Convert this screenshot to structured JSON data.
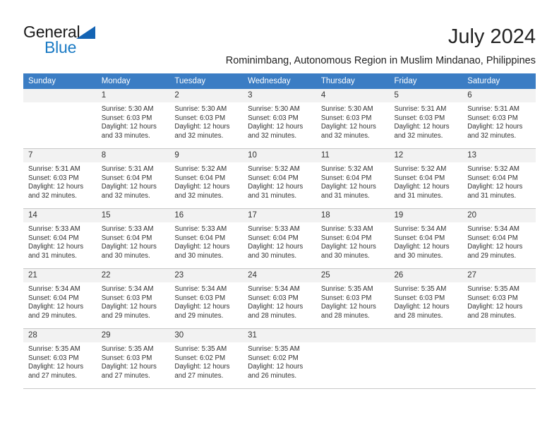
{
  "brand": {
    "name_top": "General",
    "name_bottom": "Blue",
    "accent_color": "#1a7ac4",
    "triangle_color": "#1464b4"
  },
  "header": {
    "title": "July 2024",
    "subtitle": "Rominimbang, Autonomous Region in Muslim Mindanao, Philippines"
  },
  "calendar": {
    "header_bg": "#3b7dc4",
    "daynum_bg": "#f2f2f2",
    "weekday_headers": [
      "Sunday",
      "Monday",
      "Tuesday",
      "Wednesday",
      "Thursday",
      "Friday",
      "Saturday"
    ],
    "weeks": [
      [
        {
          "day": "",
          "lines": []
        },
        {
          "day": "1",
          "lines": [
            "Sunrise: 5:30 AM",
            "Sunset: 6:03 PM",
            "Daylight: 12 hours",
            "and 33 minutes."
          ]
        },
        {
          "day": "2",
          "lines": [
            "Sunrise: 5:30 AM",
            "Sunset: 6:03 PM",
            "Daylight: 12 hours",
            "and 32 minutes."
          ]
        },
        {
          "day": "3",
          "lines": [
            "Sunrise: 5:30 AM",
            "Sunset: 6:03 PM",
            "Daylight: 12 hours",
            "and 32 minutes."
          ]
        },
        {
          "day": "4",
          "lines": [
            "Sunrise: 5:30 AM",
            "Sunset: 6:03 PM",
            "Daylight: 12 hours",
            "and 32 minutes."
          ]
        },
        {
          "day": "5",
          "lines": [
            "Sunrise: 5:31 AM",
            "Sunset: 6:03 PM",
            "Daylight: 12 hours",
            "and 32 minutes."
          ]
        },
        {
          "day": "6",
          "lines": [
            "Sunrise: 5:31 AM",
            "Sunset: 6:03 PM",
            "Daylight: 12 hours",
            "and 32 minutes."
          ]
        }
      ],
      [
        {
          "day": "7",
          "lines": [
            "Sunrise: 5:31 AM",
            "Sunset: 6:03 PM",
            "Daylight: 12 hours",
            "and 32 minutes."
          ]
        },
        {
          "day": "8",
          "lines": [
            "Sunrise: 5:31 AM",
            "Sunset: 6:04 PM",
            "Daylight: 12 hours",
            "and 32 minutes."
          ]
        },
        {
          "day": "9",
          "lines": [
            "Sunrise: 5:32 AM",
            "Sunset: 6:04 PM",
            "Daylight: 12 hours",
            "and 32 minutes."
          ]
        },
        {
          "day": "10",
          "lines": [
            "Sunrise: 5:32 AM",
            "Sunset: 6:04 PM",
            "Daylight: 12 hours",
            "and 31 minutes."
          ]
        },
        {
          "day": "11",
          "lines": [
            "Sunrise: 5:32 AM",
            "Sunset: 6:04 PM",
            "Daylight: 12 hours",
            "and 31 minutes."
          ]
        },
        {
          "day": "12",
          "lines": [
            "Sunrise: 5:32 AM",
            "Sunset: 6:04 PM",
            "Daylight: 12 hours",
            "and 31 minutes."
          ]
        },
        {
          "day": "13",
          "lines": [
            "Sunrise: 5:32 AM",
            "Sunset: 6:04 PM",
            "Daylight: 12 hours",
            "and 31 minutes."
          ]
        }
      ],
      [
        {
          "day": "14",
          "lines": [
            "Sunrise: 5:33 AM",
            "Sunset: 6:04 PM",
            "Daylight: 12 hours",
            "and 31 minutes."
          ]
        },
        {
          "day": "15",
          "lines": [
            "Sunrise: 5:33 AM",
            "Sunset: 6:04 PM",
            "Daylight: 12 hours",
            "and 30 minutes."
          ]
        },
        {
          "day": "16",
          "lines": [
            "Sunrise: 5:33 AM",
            "Sunset: 6:04 PM",
            "Daylight: 12 hours",
            "and 30 minutes."
          ]
        },
        {
          "day": "17",
          "lines": [
            "Sunrise: 5:33 AM",
            "Sunset: 6:04 PM",
            "Daylight: 12 hours",
            "and 30 minutes."
          ]
        },
        {
          "day": "18",
          "lines": [
            "Sunrise: 5:33 AM",
            "Sunset: 6:04 PM",
            "Daylight: 12 hours",
            "and 30 minutes."
          ]
        },
        {
          "day": "19",
          "lines": [
            "Sunrise: 5:34 AM",
            "Sunset: 6:04 PM",
            "Daylight: 12 hours",
            "and 30 minutes."
          ]
        },
        {
          "day": "20",
          "lines": [
            "Sunrise: 5:34 AM",
            "Sunset: 6:04 PM",
            "Daylight: 12 hours",
            "and 29 minutes."
          ]
        }
      ],
      [
        {
          "day": "21",
          "lines": [
            "Sunrise: 5:34 AM",
            "Sunset: 6:04 PM",
            "Daylight: 12 hours",
            "and 29 minutes."
          ]
        },
        {
          "day": "22",
          "lines": [
            "Sunrise: 5:34 AM",
            "Sunset: 6:03 PM",
            "Daylight: 12 hours",
            "and 29 minutes."
          ]
        },
        {
          "day": "23",
          "lines": [
            "Sunrise: 5:34 AM",
            "Sunset: 6:03 PM",
            "Daylight: 12 hours",
            "and 29 minutes."
          ]
        },
        {
          "day": "24",
          "lines": [
            "Sunrise: 5:34 AM",
            "Sunset: 6:03 PM",
            "Daylight: 12 hours",
            "and 28 minutes."
          ]
        },
        {
          "day": "25",
          "lines": [
            "Sunrise: 5:35 AM",
            "Sunset: 6:03 PM",
            "Daylight: 12 hours",
            "and 28 minutes."
          ]
        },
        {
          "day": "26",
          "lines": [
            "Sunrise: 5:35 AM",
            "Sunset: 6:03 PM",
            "Daylight: 12 hours",
            "and 28 minutes."
          ]
        },
        {
          "day": "27",
          "lines": [
            "Sunrise: 5:35 AM",
            "Sunset: 6:03 PM",
            "Daylight: 12 hours",
            "and 28 minutes."
          ]
        }
      ],
      [
        {
          "day": "28",
          "lines": [
            "Sunrise: 5:35 AM",
            "Sunset: 6:03 PM",
            "Daylight: 12 hours",
            "and 27 minutes."
          ]
        },
        {
          "day": "29",
          "lines": [
            "Sunrise: 5:35 AM",
            "Sunset: 6:03 PM",
            "Daylight: 12 hours",
            "and 27 minutes."
          ]
        },
        {
          "day": "30",
          "lines": [
            "Sunrise: 5:35 AM",
            "Sunset: 6:02 PM",
            "Daylight: 12 hours",
            "and 27 minutes."
          ]
        },
        {
          "day": "31",
          "lines": [
            "Sunrise: 5:35 AM",
            "Sunset: 6:02 PM",
            "Daylight: 12 hours",
            "and 26 minutes."
          ]
        },
        {
          "day": "",
          "lines": []
        },
        {
          "day": "",
          "lines": []
        },
        {
          "day": "",
          "lines": []
        }
      ]
    ]
  }
}
